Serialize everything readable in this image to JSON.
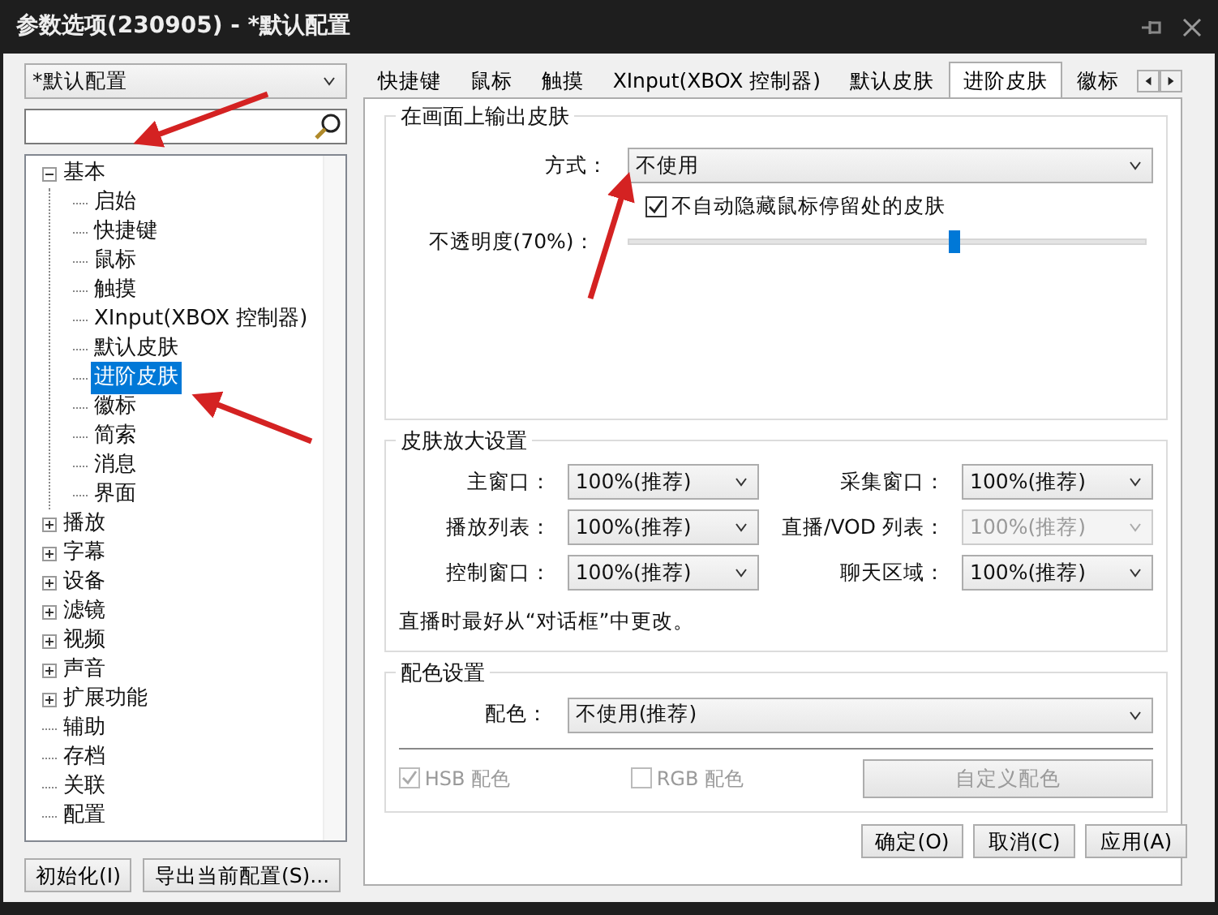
{
  "window": {
    "title": "参数选项(230905) - *默认配置"
  },
  "profile_select": {
    "value": "*默认配置"
  },
  "tree": [
    {
      "label": "基本",
      "expanded": true,
      "selected": false,
      "children": [
        {
          "label": "启始",
          "selected": false
        },
        {
          "label": "快捷键",
          "selected": false
        },
        {
          "label": "鼠标",
          "selected": false
        },
        {
          "label": "触摸",
          "selected": false
        },
        {
          "label": "XInput(XBOX 控制器)",
          "selected": false
        },
        {
          "label": "默认皮肤",
          "selected": false
        },
        {
          "label": "进阶皮肤",
          "selected": true
        },
        {
          "label": "徽标",
          "selected": false
        },
        {
          "label": "简索",
          "selected": false
        },
        {
          "label": "消息",
          "selected": false
        },
        {
          "label": "界面",
          "selected": false
        }
      ]
    },
    {
      "label": "播放",
      "expanded": false,
      "selected": false
    },
    {
      "label": "字幕",
      "expanded": false,
      "selected": false
    },
    {
      "label": "设备",
      "expanded": false,
      "selected": false
    },
    {
      "label": "滤镜",
      "expanded": false,
      "selected": false
    },
    {
      "label": "视频",
      "expanded": false,
      "selected": false
    },
    {
      "label": "声音",
      "expanded": false,
      "selected": false
    },
    {
      "label": "扩展功能",
      "expanded": false,
      "selected": false
    },
    {
      "label": "辅助",
      "selected": false
    },
    {
      "label": "存档",
      "selected": false
    },
    {
      "label": "关联",
      "selected": false
    },
    {
      "label": "配置",
      "selected": false
    }
  ],
  "left_buttons": [
    "初始化(I)",
    "导出当前配置(S)..."
  ],
  "tabs": [
    {
      "label": "快捷键",
      "selected": false
    },
    {
      "label": "鼠标",
      "selected": false
    },
    {
      "label": "触摸",
      "selected": false
    },
    {
      "label": "XInput(XBOX 控制器)",
      "selected": false
    },
    {
      "label": "默认皮肤",
      "selected": false
    },
    {
      "label": "进阶皮肤",
      "selected": true
    },
    {
      "label": "徽标",
      "selected": false
    }
  ],
  "output_group": {
    "title": "在画面上输出皮肤",
    "mode": {
      "label": "方式：",
      "value": "不使用"
    },
    "hide_cursor": {
      "label": "不自动隐藏鼠标停留处的皮肤",
      "checked": true
    },
    "opacity": {
      "label": "不透明度(70%)：",
      "level": 0.63
    }
  },
  "zoom_group": {
    "title": "皮肤放大设置",
    "fields": [
      {
        "label": "主窗口：",
        "value": "100%(推荐)",
        "disabled": false
      },
      {
        "label": "采集窗口：",
        "value": "100%(推荐)",
        "disabled": false
      },
      {
        "label": "播放列表：",
        "value": "100%(推荐)",
        "disabled": false
      },
      {
        "label": "直播/VOD 列表：",
        "value": "100%(推荐)",
        "disabled": true
      },
      {
        "label": "控制窗口：",
        "value": "100%(推荐)",
        "disabled": false
      },
      {
        "label": "聊天区域：",
        "value": "100%(推荐)",
        "disabled": false
      }
    ],
    "note": "直播时最好从“对话框”中更改。"
  },
  "color_group": {
    "title": "配色设置",
    "scheme": {
      "label": "配色：",
      "value": "不使用(推荐)"
    },
    "options": [
      {
        "label": "HSB 配色",
        "checked": true,
        "disabled": true
      },
      {
        "label": "RGB 配色",
        "checked": false,
        "disabled": true
      }
    ],
    "custom_button": {
      "label": "自定义配色",
      "disabled": true
    }
  },
  "buttons": [
    "确定(O)",
    "取消(C)",
    "应用(A)"
  ]
}
